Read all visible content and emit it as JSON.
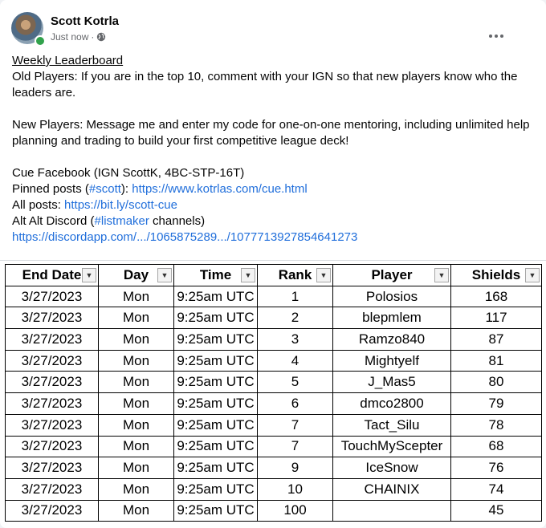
{
  "post": {
    "author": "Scott Kotrla",
    "time": "Just now",
    "separator": "·",
    "lines": {
      "heading": "Weekly Leaderboard",
      "old_players": "Old Players: If you are in the top 10, comment with your IGN so that new players know who the leaders are.",
      "new_players": "New Players: Message me and enter my code for one-on-one mentoring, including unlimited help planning and trading to build your first competitive league deck!",
      "cue_facebook": "Cue Facebook (IGN ScottK, 4BC-STP-16T)",
      "pinned_prefix": "Pinned posts (",
      "pinned_tag": "#scott",
      "pinned_mid": "): ",
      "pinned_link": "https://www.kotrlas.com/cue.html",
      "all_prefix": "All posts: ",
      "all_link": "https://bit.ly/scott-cue",
      "alt_prefix": "Alt Alt Discord (",
      "alt_tag": "#listmaker",
      "alt_suffix": " channels)",
      "discord_link": "https://discordapp.com/.../1065875289.../1077713927854641273"
    }
  },
  "colors": {
    "link": "#216fdb",
    "online": "#31a24c"
  },
  "table": {
    "headers": [
      "End Date",
      "Day",
      "Time",
      "Rank",
      "Player",
      "Shields"
    ],
    "rows": [
      [
        "3/27/2023",
        "Mon",
        "9:25am UTC",
        "1",
        "Polosios",
        "168"
      ],
      [
        "3/27/2023",
        "Mon",
        "9:25am UTC",
        "2",
        "blepmlem",
        "117"
      ],
      [
        "3/27/2023",
        "Mon",
        "9:25am UTC",
        "3",
        "Ramzo840",
        "87"
      ],
      [
        "3/27/2023",
        "Mon",
        "9:25am UTC",
        "4",
        "Mightyelf",
        "81"
      ],
      [
        "3/27/2023",
        "Mon",
        "9:25am UTC",
        "5",
        "J_Mas5",
        "80"
      ],
      [
        "3/27/2023",
        "Mon",
        "9:25am UTC",
        "6",
        "dmco2800",
        "79"
      ],
      [
        "3/27/2023",
        "Mon",
        "9:25am UTC",
        "7",
        "Tact_Silu",
        "78"
      ],
      [
        "3/27/2023",
        "Mon",
        "9:25am UTC",
        "7",
        "TouchMyScepter",
        "68"
      ],
      [
        "3/27/2023",
        "Mon",
        "9:25am UTC",
        "9",
        "IceSnow",
        "76"
      ],
      [
        "3/27/2023",
        "Mon",
        "9:25am UTC",
        "10",
        "CHAINIX",
        "74"
      ],
      [
        "3/27/2023",
        "Mon",
        "9:25am UTC",
        "100",
        "",
        "45"
      ]
    ]
  }
}
